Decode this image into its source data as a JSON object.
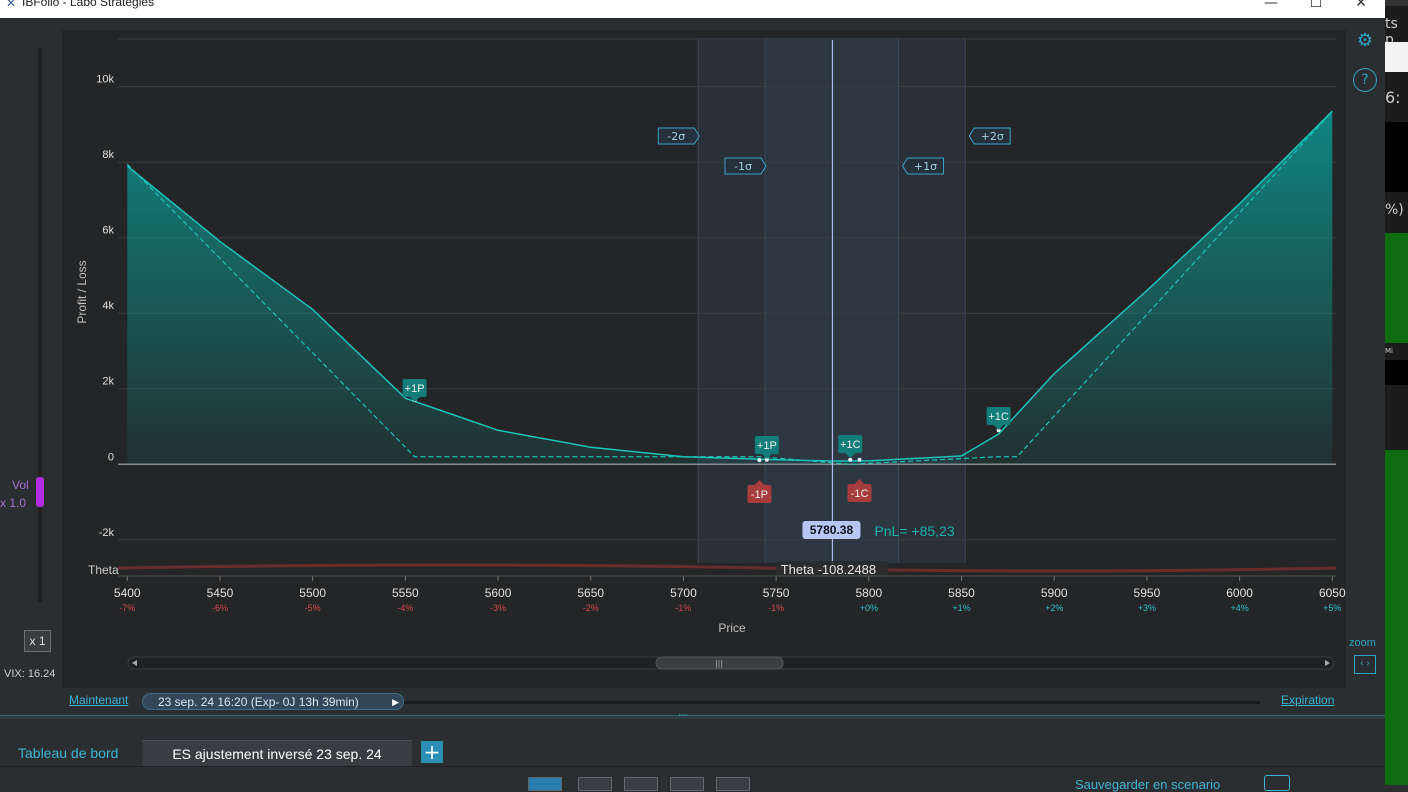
{
  "window": {
    "title": "IBFolio - Labo Strategies",
    "app_icon": "✕",
    "minimize": "—",
    "maximize": "☐",
    "close": "✕"
  },
  "right_strip": {
    "text_1": "ts p",
    "text_2": "6:",
    "text_3": "%)",
    "text_4": "Mi"
  },
  "vol_control": {
    "label": "Vol",
    "multiplier": "x 1.0",
    "level": 1.0
  },
  "x1_button": "x 1",
  "vix": "VIX: 16.24",
  "icons": {
    "gear": "⚙",
    "help": "?",
    "zoom_arrows": "‹ ›"
  },
  "zoom_label": "zoom",
  "chart_data": {
    "type": "area",
    "ylabel": "Profit / Loss",
    "xlabel": "Price",
    "xlim": [
      5395,
      6052
    ],
    "ylim": [
      -2800,
      11500
    ],
    "y_ticks": [
      {
        "value": 10000,
        "label": "10k"
      },
      {
        "value": 8000,
        "label": "8k"
      },
      {
        "value": 6000,
        "label": "6k"
      },
      {
        "value": 4000,
        "label": "4k"
      },
      {
        "value": 2000,
        "label": "2k"
      },
      {
        "value": 0,
        "label": "0"
      },
      {
        "value": -2000,
        "label": "-2k"
      }
    ],
    "x_ticks": [
      {
        "value": 5400,
        "label": "5400",
        "pct": "-7%"
      },
      {
        "value": 5450,
        "label": "5450",
        "pct": "-6%"
      },
      {
        "value": 5500,
        "label": "5500",
        "pct": "-5%"
      },
      {
        "value": 5550,
        "label": "5550",
        "pct": "-4%"
      },
      {
        "value": 5600,
        "label": "5600",
        "pct": "-3%"
      },
      {
        "value": 5650,
        "label": "5650",
        "pct": "-2%"
      },
      {
        "value": 5700,
        "label": "5700",
        "pct": "-1%"
      },
      {
        "value": 5750,
        "label": "5750",
        "pct": "-1%"
      },
      {
        "value": 5800,
        "label": "5800",
        "pct": "+0%"
      },
      {
        "value": 5850,
        "label": "5850",
        "pct": "+1%"
      },
      {
        "value": 5900,
        "label": "5900",
        "pct": "+2%"
      },
      {
        "value": 5950,
        "label": "5950",
        "pct": "+3%"
      },
      {
        "value": 6000,
        "label": "6000",
        "pct": "+4%"
      },
      {
        "value": 6050,
        "label": "6050",
        "pct": "+5%"
      }
    ],
    "series": [
      {
        "name": "",
        "style": "solid",
        "points": [
          [
            5400,
            7900
          ],
          [
            5450,
            5900
          ],
          [
            5500,
            4100
          ],
          [
            5550,
            1750
          ],
          [
            5600,
            900
          ],
          [
            5650,
            450
          ],
          [
            5700,
            200
          ],
          [
            5750,
            120
          ],
          [
            5780,
            85
          ],
          [
            5800,
            90
          ],
          [
            5850,
            220
          ],
          [
            5870,
            800
          ],
          [
            5900,
            2400
          ],
          [
            5950,
            4600
          ],
          [
            6000,
            6900
          ],
          [
            6050,
            9350
          ]
        ]
      },
      {
        "name": "",
        "style": "dashed",
        "points": [
          [
            5400,
            7950
          ],
          [
            5555,
            200
          ],
          [
            5741,
            200
          ],
          [
            5790,
            0
          ],
          [
            5870,
            200
          ],
          [
            5880,
            200
          ],
          [
            6050,
            9350
          ]
        ]
      }
    ],
    "current_price": 5780.38,
    "current_price_label": "5780.38",
    "pnl_label": "PnL= +85,23",
    "sigma_bands": [
      {
        "label": "-2σ",
        "value": 5708
      },
      {
        "label": "-1σ",
        "value": 5744
      },
      {
        "label": "+1σ",
        "value": 5816
      },
      {
        "label": "+2σ",
        "value": 5852
      }
    ],
    "position_markers": [
      {
        "label": "+1P",
        "value": 5555,
        "pnl": 1700,
        "type": "long"
      },
      {
        "label": "+1P",
        "value": 5745,
        "pnl": 120,
        "type": "long"
      },
      {
        "label": "-1P",
        "value": 5741,
        "pnl": 110,
        "type": "short"
      },
      {
        "label": "+1C",
        "value": 5790,
        "pnl": 120,
        "type": "long"
      },
      {
        "label": "-1C",
        "value": 5795,
        "pnl": 120,
        "type": "short"
      },
      {
        "label": "+1C",
        "value": 5870,
        "pnl": 900,
        "type": "long"
      }
    ],
    "theta_label": "Theta",
    "theta_value": "Theta -108.2488",
    "grid": true,
    "colors": {
      "fill": "#0e8a86",
      "line": "#1cc3bd",
      "band": "#2e3a47",
      "marker_long": "#127d7b",
      "marker_short": "#a73c3c",
      "pct_neg": "#d94a4a",
      "pct_pos": "#2ec1d4"
    }
  },
  "timeline": {
    "now_label": "Maintenant",
    "current": "23 sep. 24  16:20  (Exp- 0J 13h 39min)",
    "arrow": "▶",
    "expiration_label": "Expiration"
  },
  "splitter_grip": "·····",
  "tabs": {
    "dashboard": "Tableau de bord",
    "active": "ES ajustement inversé 23 sep. 24",
    "add": "+"
  },
  "bottom": {
    "save_scenario": "Sauvegarder en scenario"
  }
}
